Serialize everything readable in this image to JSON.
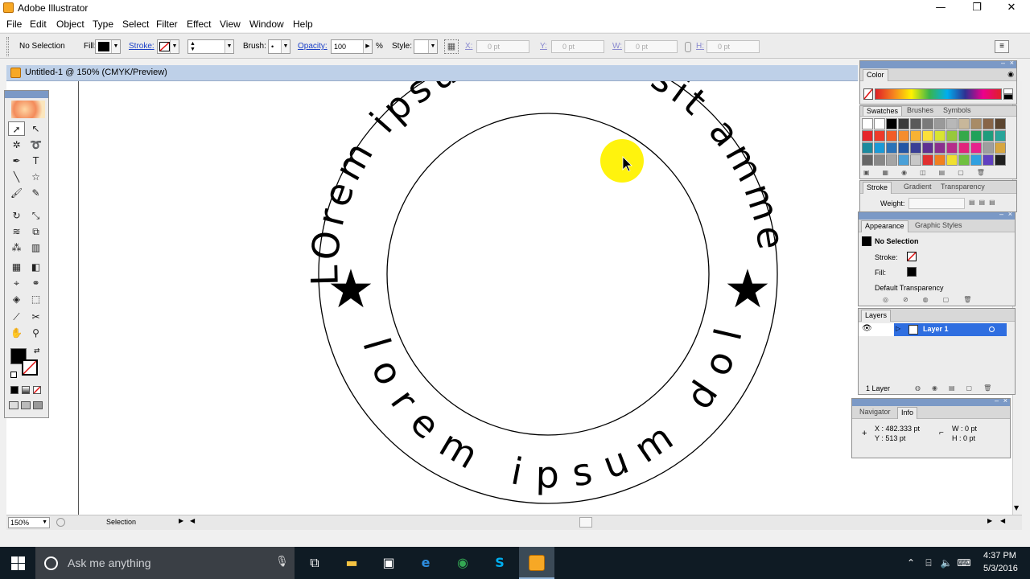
{
  "window": {
    "title": "Adobe Illustrator",
    "minimize": "—",
    "restore": "❐",
    "close": "✕"
  },
  "menu": [
    "File",
    "Edit",
    "Object",
    "Type",
    "Select",
    "Filter",
    "Effect",
    "View",
    "Window",
    "Help"
  ],
  "control": {
    "selection": "No Selection",
    "fill_label": "Fill:",
    "stroke_label": "Stroke:",
    "brush_label": "Brush:",
    "brush_value": "•",
    "opacity_label": "Opacity:",
    "opacity_value": "100",
    "opacity_unit": "%",
    "style_label": "Style:",
    "x_label": "X:",
    "x_value": "0 pt",
    "y_label": "Y:",
    "y_value": "0 pt",
    "w_label": "W:",
    "w_value": "0 pt",
    "h_label": "H:",
    "h_value": "0 pt"
  },
  "document": {
    "tab": "Untitled-1 @ 150% (CMYK/Preview)"
  },
  "artwork": {
    "top_arc_text": "LOrem ipsum dolor sit ammet",
    "bottom_arc_text": "lorem ipsum dolor",
    "star": "★"
  },
  "status": {
    "zoom": "150%",
    "tool": "Selection"
  },
  "panels": {
    "color": {
      "tab": "Color"
    },
    "swatches": {
      "tabs": [
        "Swatches",
        "Brushes",
        "Symbols"
      ]
    },
    "stroke": {
      "tabs": [
        "Stroke",
        "Gradient",
        "Transparency"
      ],
      "weight_label": "Weight:"
    },
    "appearance": {
      "tabs": [
        "Appearance",
        "Graphic Styles"
      ],
      "header": "No Selection",
      "stroke_label": "Stroke:",
      "fill_label": "Fill:",
      "transparency": "Default Transparency"
    },
    "layers": {
      "tab": "Layers",
      "layer_name": "Layer 1",
      "count": "1 Layer"
    },
    "info": {
      "tabs": [
        "Navigator",
        "Info"
      ],
      "x": "X : 482.333 pt",
      "y": "Y : 513 pt",
      "w": "W : 0 pt",
      "h": "H : 0 pt"
    }
  },
  "taskbar": {
    "search": "Ask me anything",
    "time": "4:37 PM",
    "date": "5/3/2016"
  },
  "colors": {
    "swatches": [
      "#ffffff",
      "#ffffff",
      "#000000",
      "#3a3a3a",
      "#5a5a5a",
      "#7a7a7a",
      "#9a9a9a",
      "#b8b8b8",
      "#c8b79a",
      "#a88b66",
      "#886548",
      "#5c4530",
      "#e6252a",
      "#ee3a2a",
      "#f25d26",
      "#f58d2c",
      "#f7b233",
      "#fbe03a",
      "#d8e432",
      "#97c93d",
      "#35a94a",
      "#1fa25a",
      "#1f9c7c",
      "#2aa59a",
      "#1c8a9e",
      "#1b9ad7",
      "#2b73b8",
      "#2456a5",
      "#3a3f96",
      "#5e3192",
      "#8a2f8e",
      "#b62c8a",
      "#e2247c",
      "#e7218d",
      "#9e9e9e",
      "#d7a640",
      "#666666",
      "#888888",
      "#a5a5a5",
      "#4aa0d8",
      "#c8c8c8",
      "#e03030",
      "#f08020",
      "#f0e030",
      "#70c040",
      "#30a0e0",
      "#6040c0",
      "#202020"
    ]
  }
}
